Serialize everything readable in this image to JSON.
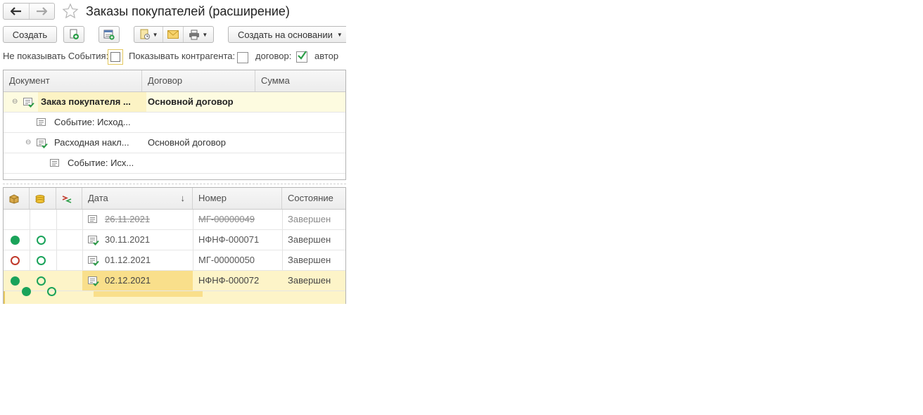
{
  "window": {
    "title": "Заказы покупателей (расширение)"
  },
  "toolbar": {
    "create_label": "Создать",
    "create_based_label": "Создать на основании"
  },
  "filters": {
    "hide_events_label": "Не показывать События:",
    "show_contractor_label": "Показывать контрагента:",
    "contract_label": "договор:",
    "author_label": "автор"
  },
  "tree": {
    "headers": [
      "Документ",
      "Договор",
      "Сумма"
    ],
    "rows": [
      {
        "doc": "Заказ покупателя ...",
        "contract": "Основной договор"
      },
      {
        "doc": "Событие: Исход...",
        "contract": ""
      },
      {
        "doc": "Расходная накл...",
        "contract": "Основной договор"
      },
      {
        "doc": "Событие: Исх...",
        "contract": ""
      }
    ]
  },
  "list": {
    "headers": {
      "date": "Дата",
      "number": "Номер",
      "state": "Состояние",
      "sort_arrow": "↓"
    },
    "rows": [
      {
        "date": "26.11.2021",
        "number": "МГ-00000049",
        "state": "Завершен"
      },
      {
        "date": "30.11.2021",
        "number": "НФНФ-000071",
        "state": "Завершен"
      },
      {
        "date": "01.12.2021",
        "number": "МГ-00000050",
        "state": "Завершен"
      },
      {
        "date": "02.12.2021",
        "number": "НФНФ-000072",
        "state": "Завершен"
      }
    ]
  },
  "colors": {
    "selected_row": "#fdf4c8",
    "selected_cell": "#f9df8b",
    "green": "#1aa35a",
    "red": "#c0392b"
  }
}
